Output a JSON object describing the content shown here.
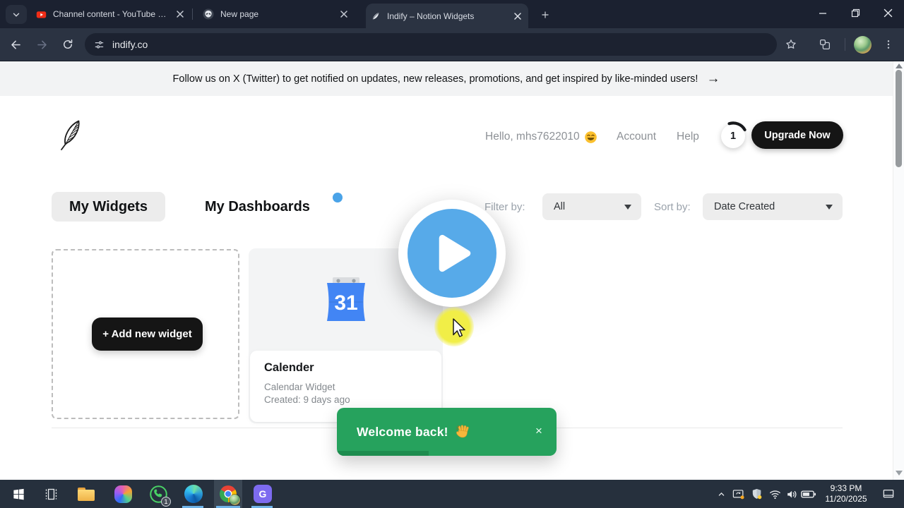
{
  "colors": {
    "accent-blue": "#4aa3e8",
    "play-blue": "#57aae9",
    "toast-green": "#26a25d",
    "toast-progress": "#1d8c4e",
    "calendar-blue": "#4285f4",
    "highlight-yellow": "#f1ee47",
    "upgrade-black": "#151515"
  },
  "browser": {
    "tabs": [
      {
        "title": "Channel content - YouTube Stu"
      },
      {
        "title": "New page"
      },
      {
        "title": "Indify – Notion Widgets"
      }
    ],
    "url": "indify.co"
  },
  "banner": {
    "text": "Follow us on X (Twitter) to get notified on updates, new releases, promotions, and get inspired by like-minded users!",
    "arrow": "→"
  },
  "header": {
    "greeting": "Hello, mhs7622010",
    "account": "Account",
    "help": "Help",
    "credits": "1",
    "upgrade": "Upgrade Now"
  },
  "nav": {
    "my_widgets": "My Widgets",
    "my_dashboards": "My Dashboards"
  },
  "filters": {
    "filter_label": "Filter by:",
    "filter_value": "All",
    "sort_label": "Sort by:",
    "sort_value": "Date Created"
  },
  "widgets": {
    "add_label": "+ Add new widget",
    "cards": [
      {
        "title": "Calender",
        "subtitle": "Calendar Widget",
        "created": "Created: 9 days ago",
        "icon_label": "31"
      }
    ]
  },
  "toast": {
    "message": "Welcome back!",
    "close": "×"
  },
  "taskbar": {
    "whatsapp_badge": "1",
    "time": "9:33 PM",
    "date": "11/20/2025"
  }
}
